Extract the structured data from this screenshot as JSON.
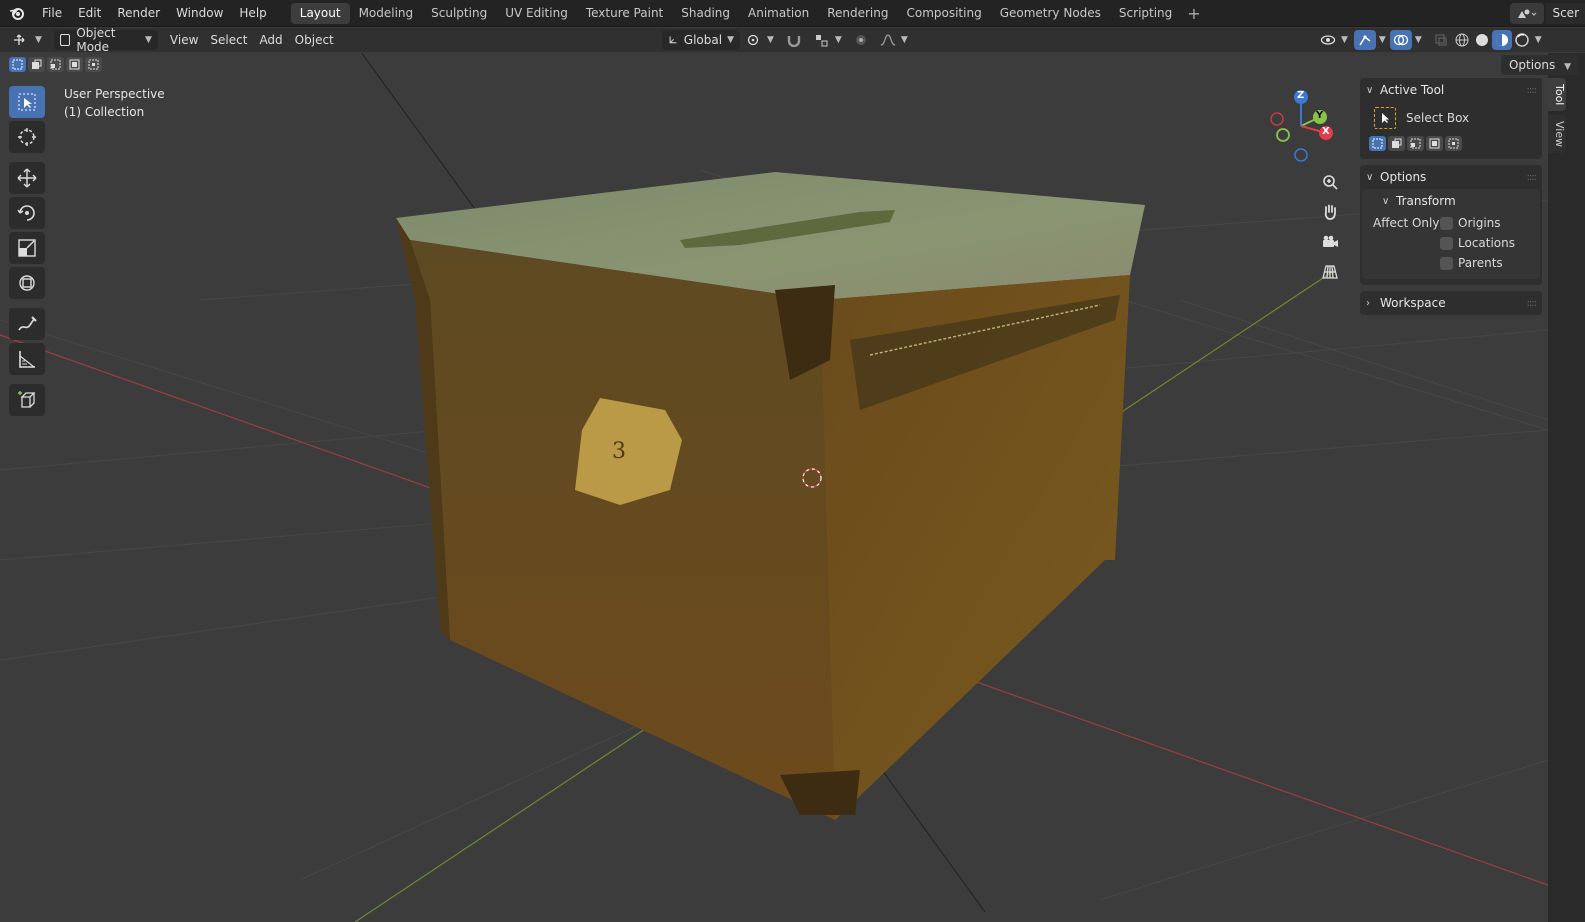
{
  "menubar": {
    "items": [
      "File",
      "Edit",
      "Render",
      "Window",
      "Help"
    ],
    "workspaces": [
      "Layout",
      "Modeling",
      "Sculpting",
      "UV Editing",
      "Texture Paint",
      "Shading",
      "Animation",
      "Rendering",
      "Compositing",
      "Geometry Nodes",
      "Scripting"
    ],
    "active_workspace": "Layout",
    "scene_label": "Scer"
  },
  "header": {
    "mode": "Object Mode",
    "menus": [
      "View",
      "Select",
      "Add",
      "Object"
    ],
    "orientation": "Global",
    "options": "Options"
  },
  "viewport": {
    "view_name": "User Perspective",
    "collection": "(1) Collection"
  },
  "gizmo": {
    "z": "Z",
    "y": "Y",
    "x": "X"
  },
  "npanel": {
    "active_tool_title": "Active Tool",
    "tool_name": "Select Box",
    "options_title": "Options",
    "transform_title": "Transform",
    "affect_only": "Affect Only",
    "checks": [
      "Origins",
      "Locations",
      "Parents"
    ],
    "workspace_title": "Workspace",
    "tabs": [
      "Tool",
      "View"
    ]
  },
  "colors": {
    "accent": "#4772b3",
    "x_axis": "#e23b4e",
    "y_axis": "#8bc34a",
    "z_axis": "#3a78d4"
  }
}
